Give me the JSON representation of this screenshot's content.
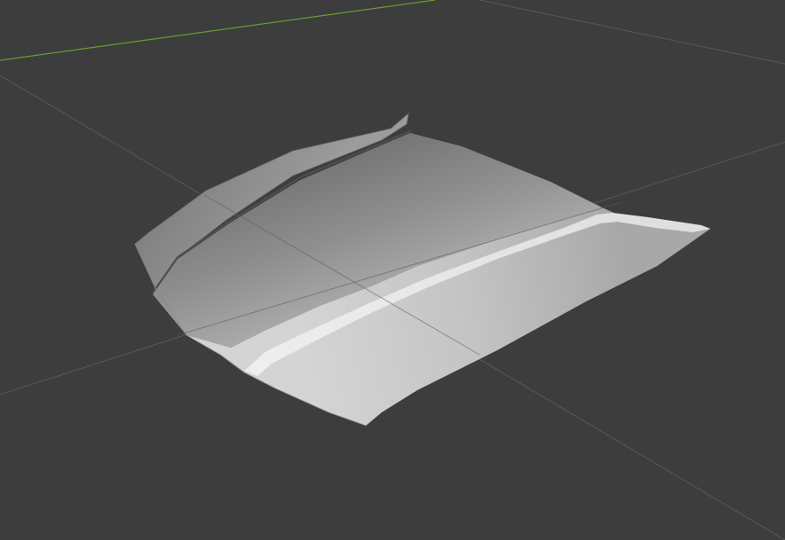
{
  "viewport": {
    "background_color": "#3d3d3d",
    "grid_line_color": "#585858",
    "x_axis_color": "#6a9a33",
    "mesh_highlight_color": "#e9e9e9",
    "mesh_shadow_color": "#6a6a6a"
  }
}
